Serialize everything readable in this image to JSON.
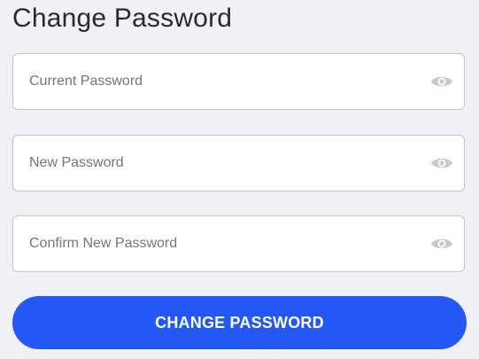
{
  "title": "Change Password",
  "fields": {
    "current": {
      "placeholder": "Current Password",
      "value": ""
    },
    "new": {
      "placeholder": "New Password",
      "value": ""
    },
    "confirm": {
      "placeholder": "Confirm New Password",
      "value": ""
    }
  },
  "icons": {
    "toggle": "eye-icon"
  },
  "submit_label": "CHANGE PASSWORD",
  "colors": {
    "accent": "#2358f5",
    "background": "#f0f1f7",
    "icon": "#c8c8c8"
  }
}
